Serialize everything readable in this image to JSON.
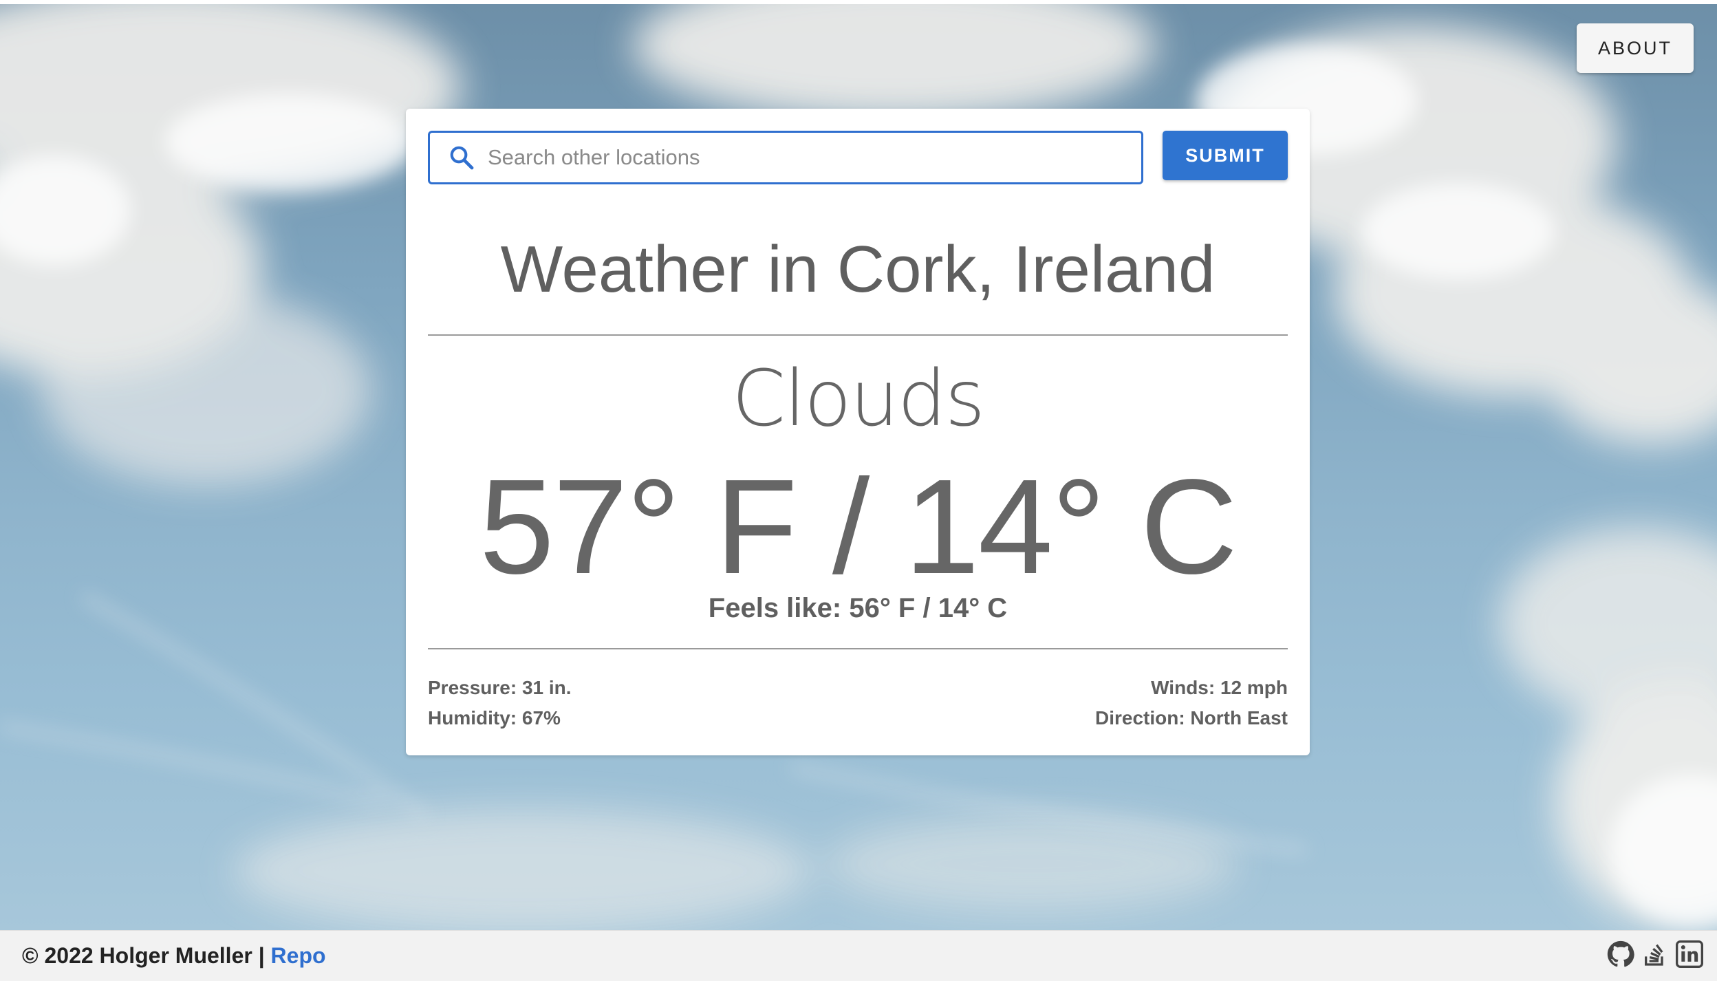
{
  "header": {
    "about_label": "ABOUT"
  },
  "search": {
    "placeholder": "Search other locations",
    "value": "",
    "submit_label": "SUBMIT"
  },
  "weather": {
    "title": "Weather in Cork, Ireland",
    "condition": "Clouds",
    "temperature": "57° F / 14° C",
    "feels_like": "Feels like: 56° F / 14° C",
    "pressure": "Pressure: 31 in.",
    "humidity": "Humidity: 67%",
    "winds": "Winds: 12 mph",
    "direction": "Direction: North East"
  },
  "footer": {
    "copyright": "© 2022 Holger Mueller |",
    "repo_label": "Repo",
    "icons": [
      "github-icon",
      "stackoverflow-icon",
      "linkedin-icon"
    ]
  },
  "colors": {
    "accent": "#2f74d0",
    "text": "#5f5f5f",
    "footer_bg": "#f2f2f2"
  }
}
